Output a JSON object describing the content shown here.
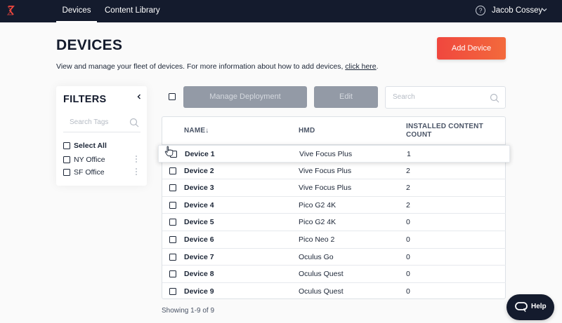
{
  "nav": {
    "tabs": [
      {
        "label": "Devices",
        "active": true
      },
      {
        "label": "Content Library",
        "active": false
      }
    ],
    "user_name": "Jacob Cossey"
  },
  "header": {
    "title": "DEVICES",
    "description": "View and manage your fleet of devices. For more information about how to add devices,",
    "link_text": "click here",
    "description_end": ".",
    "add_button": "Add Device"
  },
  "filters": {
    "title": "FILTERS",
    "search_placeholder": "Search Tags",
    "select_all": "Select All",
    "tags": [
      "NY Office",
      "SF Office"
    ]
  },
  "toolbar": {
    "manage_label": "Manage Deployment",
    "edit_label": "Edit",
    "search_placeholder": "Search"
  },
  "table": {
    "columns": [
      "NAME↓",
      "HMD",
      "INSTALLED CONTENT COUNT"
    ],
    "rows": [
      {
        "name": "Device 1",
        "hmd": "Vive Focus Plus",
        "count": "1"
      },
      {
        "name": "Device 2",
        "hmd": "Vive Focus Plus",
        "count": "2"
      },
      {
        "name": "Device 3",
        "hmd": "Vive Focus Plus",
        "count": "2"
      },
      {
        "name": "Device 4",
        "hmd": "Pico G2 4K",
        "count": "2"
      },
      {
        "name": "Device 5",
        "hmd": "Pico G2 4K",
        "count": "0"
      },
      {
        "name": "Device 6",
        "hmd": "Pico Neo 2",
        "count": "0"
      },
      {
        "name": "Device 7",
        "hmd": "Oculus Go",
        "count": "0"
      },
      {
        "name": "Device 8",
        "hmd": "Oculus Quest",
        "count": "0"
      },
      {
        "name": "Device 9",
        "hmd": "Oculus Quest",
        "count": "0"
      }
    ]
  },
  "footer": {
    "showing": "Showing 1-9 of 9",
    "help_label": "Help"
  },
  "colors": {
    "nav_bg": "#141b2d",
    "accent": "#f0473e",
    "disabled_button": "#939aa6"
  },
  "icons": {
    "logo": "logo-icon",
    "help": "question-circle-icon",
    "user_menu": "chevron-down-icon",
    "collapse": "chevron-left-icon",
    "search": "search-icon",
    "kebab": "kebab-menu-icon",
    "help_widget": "chat-bubble-icon",
    "cursor": "hand-pointer-icon"
  }
}
